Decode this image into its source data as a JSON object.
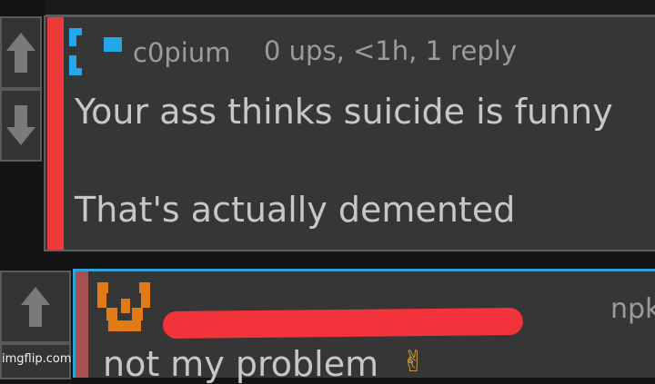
{
  "comment1": {
    "username": "c0pium",
    "meta": "0 ups, <1h, 1 reply",
    "body_line1": "Your ass thinks suicide is funny",
    "body_line2": "That's actually demented"
  },
  "comment2": {
    "username_suffix": "npk",
    "body": "not my problem"
  },
  "icons": {
    "upvote": "arrow-up-icon",
    "downvote": "arrow-down-icon",
    "avatar1": "pixel-avatar-blue",
    "avatar2": "pixel-avatar-orange",
    "emoji": "victory-hand-emoji"
  },
  "colors": {
    "depth_bar_1": "#f0393a",
    "depth_bar_2": "#a94f51",
    "highlight_border": "#31a2d6",
    "redaction": "#f2333b"
  },
  "watermark": "imgflip.com"
}
